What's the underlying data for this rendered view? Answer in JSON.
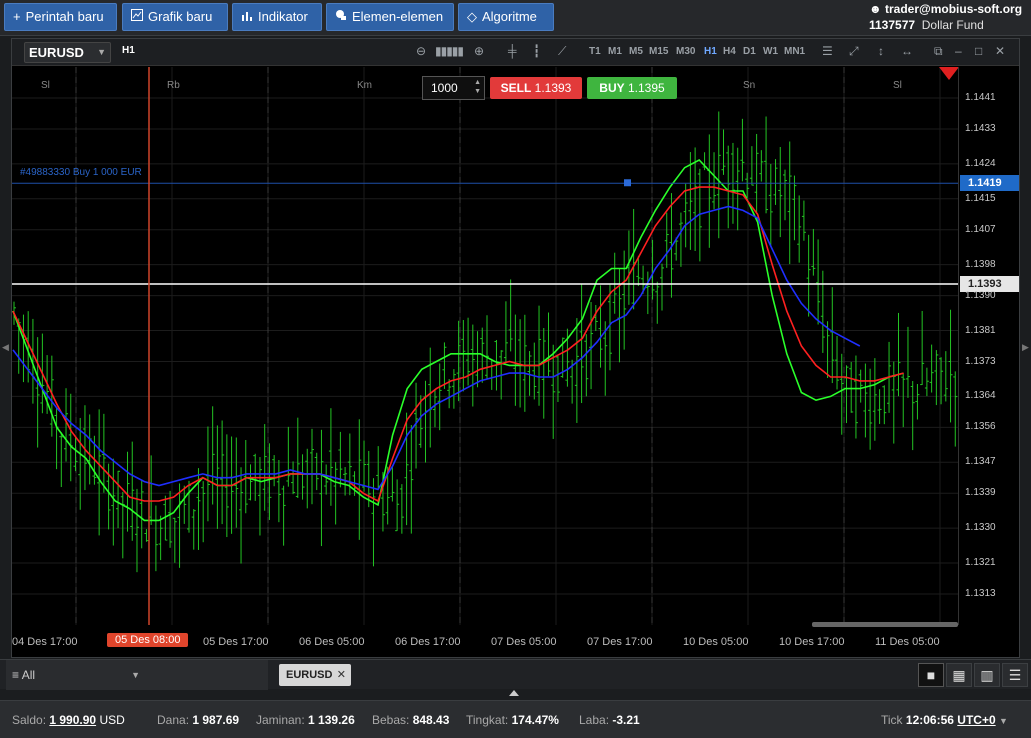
{
  "toolbar": {
    "buttons": [
      {
        "label": "Perintah baru",
        "icon": "plus-icon"
      },
      {
        "label": "Grafik baru",
        "icon": "chart-icon"
      },
      {
        "label": "Indikator",
        "icon": "bars-icon"
      },
      {
        "label": "Elemen-elemen",
        "icon": "shapes-icon"
      },
      {
        "label": "Algoritme",
        "icon": "diamond-icon"
      }
    ]
  },
  "account": {
    "user": "trader@mobius-soft.org",
    "id": "1137577",
    "fund": "Dollar Fund"
  },
  "chart_window": {
    "symbol": "EURUSD",
    "timeframe": "H1",
    "timeframes": [
      "T1",
      "M1",
      "M5",
      "M15",
      "M30",
      "H1",
      "H4",
      "D1",
      "W1",
      "MN1"
    ],
    "active_timeframe": "H1",
    "quantity": "1000",
    "sell": {
      "label": "SELL",
      "price": "1.1393"
    },
    "buy": {
      "label": "BUY",
      "price": "1.1395"
    },
    "order_line": "#49883330 Buy 1 000 EUR",
    "order_price_tag": "1.1419",
    "current_price_tag": "1.1393",
    "day_labels": [
      "Sl",
      "Rb",
      "Km",
      "Sn",
      "Sl"
    ],
    "x_labels": [
      "04 Des 17:00",
      "05 Des 08:00",
      "05 Des 17:00",
      "06 Des 05:00",
      "06 Des 17:00",
      "07 Des 05:00",
      "07 Des 17:00",
      "10 Des 05:00",
      "10 Des 17:00",
      "11 Des 05:00"
    ],
    "selected_x_label": "05 Des 08:00"
  },
  "chart_data": {
    "type": "candlestick",
    "symbol": "EURUSD",
    "timeframe": "H1",
    "y_ticks": [
      "1.1441",
      "1.1433",
      "1.1424",
      "1.1415",
      "1.1407",
      "1.1398",
      "1.1390",
      "1.1381",
      "1.1373",
      "1.1364",
      "1.1356",
      "1.1347",
      "1.1339",
      "1.1330",
      "1.1321",
      "1.1313"
    ],
    "ylim": [
      1.1305,
      1.1449
    ],
    "order_level": 1.1419,
    "current_price": 1.1393,
    "candle_color": "#23c423",
    "series": [
      {
        "color": "#2aff2a",
        "values": [
          1.1386,
          1.1376,
          1.1366,
          1.1356,
          1.1351,
          1.1348,
          1.1342,
          1.1337,
          1.1335,
          1.1332,
          1.1332,
          1.1334,
          1.1339,
          1.1343,
          1.1341,
          1.1341,
          1.1343,
          1.1342,
          1.1343,
          1.1344,
          1.1344,
          1.1344,
          1.1342,
          1.1341,
          1.1338,
          1.1336,
          1.1354,
          1.1366,
          1.1371,
          1.1373,
          1.1375,
          1.1375,
          1.1375,
          1.1373,
          1.1372,
          1.1372,
          1.1372,
          1.1375,
          1.1379,
          1.1384,
          1.1394,
          1.1397,
          1.1397,
          1.1405,
          1.1412,
          1.1418,
          1.1423,
          1.1425,
          1.1421,
          1.1417,
          1.1417,
          1.1409,
          1.139,
          1.1375,
          1.1365,
          1.1363,
          1.1364,
          1.1366,
          1.1366,
          1.1367,
          1.1369,
          1.137
        ]
      },
      {
        "color": "#ff2020",
        "values": [
          1.1386,
          1.1378,
          1.137,
          1.1362,
          1.1355,
          1.135,
          1.1346,
          1.1342,
          1.1338,
          1.1337,
          1.1337,
          1.1338,
          1.1341,
          1.1343,
          1.1341,
          1.1341,
          1.1343,
          1.1343,
          1.1343,
          1.1344,
          1.1344,
          1.1344,
          1.1343,
          1.1342,
          1.1339,
          1.1337,
          1.1348,
          1.1358,
          1.1363,
          1.1366,
          1.1368,
          1.1369,
          1.1371,
          1.1372,
          1.1373,
          1.1372,
          1.1372,
          1.1374,
          1.1376,
          1.1379,
          1.1386,
          1.1391,
          1.1394,
          1.1401,
          1.1408,
          1.1413,
          1.1417,
          1.1418,
          1.1418,
          1.1417,
          1.1416,
          1.1411,
          1.1398,
          1.1386,
          1.1377,
          1.1372,
          1.1369,
          1.1369,
          1.1368,
          1.1368,
          1.1369,
          1.137
        ]
      },
      {
        "color": "#1f2fff",
        "values": [
          1.1376,
          1.1371,
          1.1366,
          1.1361,
          1.1357,
          1.1354,
          1.135,
          1.1347,
          1.1344,
          1.1342,
          1.1341,
          1.1342,
          1.1343,
          1.1344,
          1.1343,
          1.1343,
          1.1344,
          1.1344,
          1.1344,
          1.1345,
          1.1344,
          1.1344,
          1.1343,
          1.1342,
          1.1341,
          1.134,
          1.1346,
          1.1354,
          1.1359,
          1.1362,
          1.1364,
          1.1366,
          1.1368,
          1.1369,
          1.137,
          1.137,
          1.1369,
          1.1369,
          1.1371,
          1.1374,
          1.1378,
          1.1383,
          1.1385,
          1.139,
          1.1397,
          1.1402,
          1.1408,
          1.1411,
          1.1412,
          1.1413,
          1.1412,
          1.141,
          1.1402,
          1.1394,
          1.1388,
          1.1384,
          1.1381,
          1.1379,
          1.1377
        ]
      }
    ]
  },
  "bottom_tabs": {
    "filter": "All",
    "tab": "EURUSD"
  },
  "status_bar": {
    "saldo_label": "Saldo:",
    "saldo": "1 990.90",
    "currency": "USD",
    "dana_label": "Dana:",
    "dana": "1 987.69",
    "jaminan_label": "Jaminan:",
    "jaminan": "1 139.26",
    "bebas_label": "Bebas:",
    "bebas": "848.43",
    "tingkat_label": "Tingkat:",
    "tingkat": "174.47%",
    "laba_label": "Laba:",
    "laba": "-3.21",
    "tick_label": "Tick",
    "time": "12:06:56",
    "tz": "UTC+0"
  }
}
